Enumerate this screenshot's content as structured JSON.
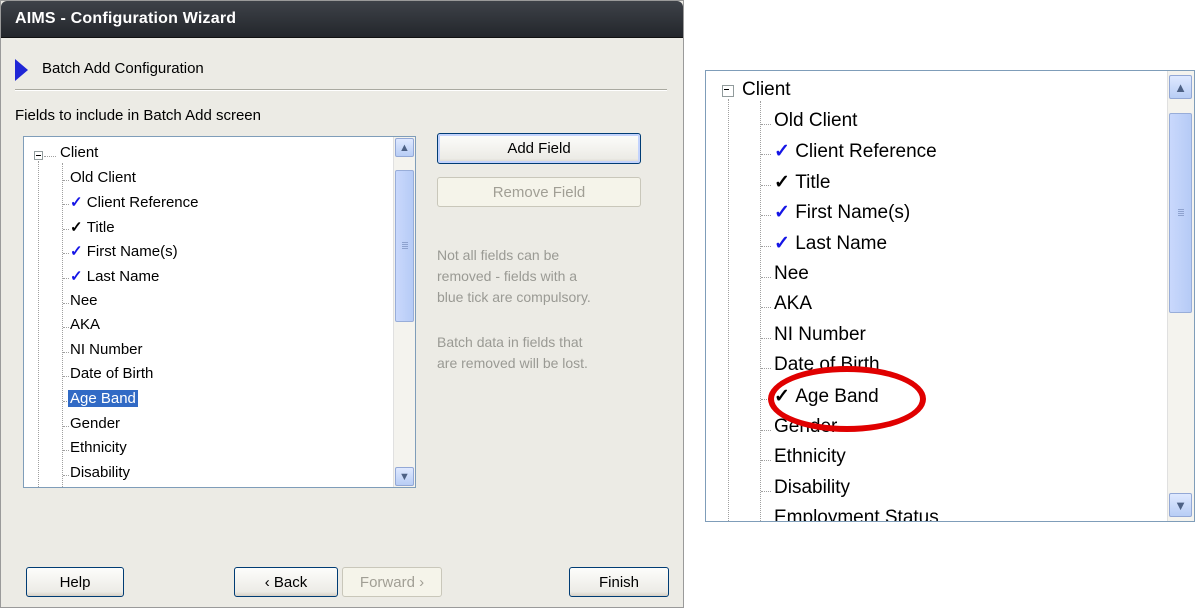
{
  "window": {
    "title": "AIMS - Configuration Wizard"
  },
  "wizard": {
    "step_title": "Batch Add Configuration",
    "fields_label": "Fields to include in Batch Add screen"
  },
  "tree": {
    "root": "Client",
    "items": [
      {
        "label": "Old Client",
        "tick": ""
      },
      {
        "label": "Client Reference",
        "tick": "✓",
        "tick_color": "#1515e6"
      },
      {
        "label": "Title",
        "tick": "✓",
        "tick_color": "#000000"
      },
      {
        "label": "First Name(s)",
        "tick": "✓",
        "tick_color": "#1515e6"
      },
      {
        "label": "Last Name",
        "tick": "✓",
        "tick_color": "#1515e6"
      },
      {
        "label": "Nee",
        "tick": ""
      },
      {
        "label": "AKA",
        "tick": ""
      },
      {
        "label": "NI Number",
        "tick": ""
      },
      {
        "label": "Date of Birth",
        "tick": ""
      },
      {
        "label": "Age Band",
        "tick": ""
      },
      {
        "label": "Gender",
        "tick": ""
      },
      {
        "label": "Ethnicity",
        "tick": ""
      },
      {
        "label": "Disability",
        "tick": ""
      },
      {
        "label": "Employment Status",
        "tick": ""
      }
    ],
    "selected_item": "Age Band"
  },
  "zoom_tree": {
    "root": "Client",
    "age_band_tick": "✓",
    "items": [
      "Old Client",
      "Client Reference",
      "Title",
      "First Name(s)",
      "Last Name",
      "Nee",
      "AKA",
      "NI Number",
      "Date of Birth",
      "Age Band",
      "Gender",
      "Ethnicity",
      "Disability",
      "Employment Status"
    ]
  },
  "buttons": {
    "add_field": "Add Field",
    "remove_field": "Remove Field",
    "help": "Help",
    "back": "‹ Back",
    "forward": "Forward ›",
    "finish": "Finish"
  },
  "notes": {
    "compulsory": [
      "Not all fields can be",
      "removed - fields with a",
      "blue tick are compulsory."
    ],
    "data_loss": [
      "Batch data in fields that",
      "are removed will be lost."
    ]
  },
  "colors": {
    "compulsory_tick": "#1515e6",
    "selection": "#316ac5",
    "highlight": "#e00000"
  }
}
